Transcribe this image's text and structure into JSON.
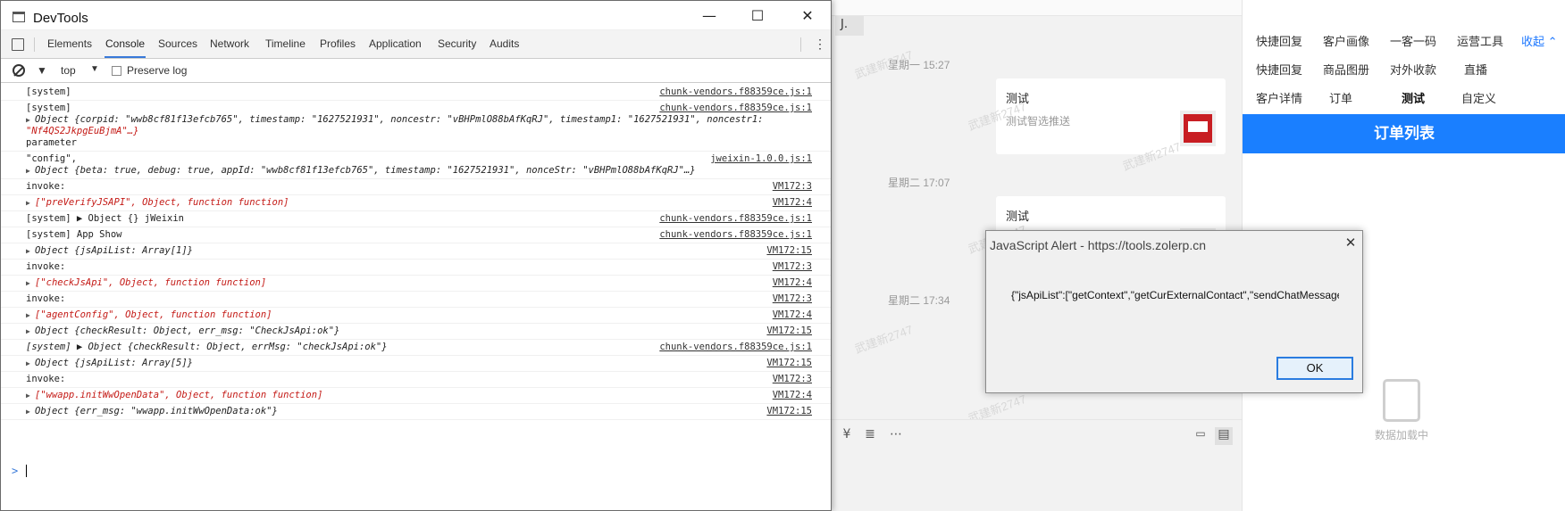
{
  "devtools": {
    "title": "DevTools",
    "window_controls": {
      "minimize": "—",
      "maximize": "☐",
      "close": "✕"
    },
    "tabs": [
      {
        "label": "Elements"
      },
      {
        "label": "Console"
      },
      {
        "label": "Sources"
      },
      {
        "label": "Network"
      },
      {
        "label": "Timeline"
      },
      {
        "label": "Profiles"
      },
      {
        "label": "Application"
      },
      {
        "label": "Security"
      },
      {
        "label": "Audits"
      }
    ],
    "active_tab": "Console",
    "filter": {
      "context": "top",
      "preserve_log_label": "Preserve log"
    },
    "prompt_symbol": ">"
  },
  "console": {
    "r1": {
      "text": "[system]",
      "src": "chunk-vendors.f88359ce.js:1"
    },
    "r2": {
      "text": "[system]",
      "src": "chunk-vendors.f88359ce.js:1",
      "line1": "Object {corpid: \"wwb8cf81f13efcb765\", timestamp: \"1627521931\", noncestr: \"vBHPmlO88bAfKqRJ\", timestamp1: \"1627521931\", noncestr1:",
      "line2": "\"Nf4QS2JkpgEuBjmA\"…}",
      "line3": "parameter"
    },
    "r3": {
      "text": "\"config\",",
      "src": "jweixin-1.0.0.js:1",
      "line1": "Object {beta: true, debug: true, appId: \"wwb8cf81f13efcb765\", timestamp: \"1627521931\", nonceStr: \"vBHPmlO88bAfKqRJ\"…}"
    },
    "r4": {
      "text": "invoke:",
      "src": "VM172:3"
    },
    "r5": {
      "text": "[\"preVerifyJSAPI\", Object, function function]",
      "src": "VM172:4"
    },
    "r6": {
      "text": "[system] ▶ Object {} jWeixin",
      "src": "chunk-vendors.f88359ce.js:1"
    },
    "r7": {
      "text": "[system] App Show",
      "src": "chunk-vendors.f88359ce.js:1"
    },
    "r8": {
      "text": "Object {jsApiList: Array[1]}",
      "src": "VM172:15"
    },
    "r9": {
      "text": "invoke:",
      "src": "VM172:3"
    },
    "r10": {
      "text": "[\"checkJsApi\", Object, function function]",
      "src": "VM172:4"
    },
    "r11": {
      "text": "invoke:",
      "src": "VM172:3"
    },
    "r12": {
      "text": "[\"agentConfig\", Object, function function]",
      "src": "VM172:4"
    },
    "r13": {
      "text": "Object {checkResult: Object, err_msg: \"CheckJsApi:ok\"}",
      "src": "VM172:15"
    },
    "r14": {
      "text": "[system] ▶ Object {checkResult: Object, errMsg: \"checkJsApi:ok\"}",
      "src": "chunk-vendors.f88359ce.js:1"
    },
    "r15": {
      "text": "Object {jsApiList: Array[5]}",
      "src": "VM172:15"
    },
    "r16": {
      "text": "invoke:",
      "src": "VM172:3"
    },
    "r17": {
      "text": "[\"wwapp.initWwOpenData\", Object, function function]",
      "src": "VM172:4"
    },
    "r18": {
      "text": "Object {err_msg: \"wwapp.initWwOpenData:ok\"}",
      "src": "VM172:15"
    }
  },
  "chat": {
    "prev_bubble": "J.",
    "timestamps": [
      "星期一 15:27",
      "星期二 17:07",
      "星期二 17:34"
    ],
    "cards": [
      {
        "title": "测试",
        "subtitle": "测试智选推送"
      },
      {
        "title": "测试"
      }
    ],
    "watermark": "武建新2747"
  },
  "sidebar": {
    "tabs_row1": [
      "快捷回复",
      "客户画像",
      "一客一码",
      "运营工具"
    ],
    "collapse_label": "收起",
    "tabs_row2": [
      "快捷回复",
      "商品图册",
      "对外收款",
      "直播"
    ],
    "tabs_row3": [
      "客户详情",
      "订单",
      "测试",
      "自定义"
    ],
    "active_tab": "测试",
    "banner": "订单列表",
    "loading_text": "数据加载中",
    "accent": "#1a7fff"
  },
  "alert": {
    "title": "JavaScript Alert - https://tools.zolerp.cn",
    "message": "{\"jsApiList\":[\"getContext\",\"getCurExternalContact\",\"sendChatMessage\"",
    "ok_label": "OK"
  }
}
